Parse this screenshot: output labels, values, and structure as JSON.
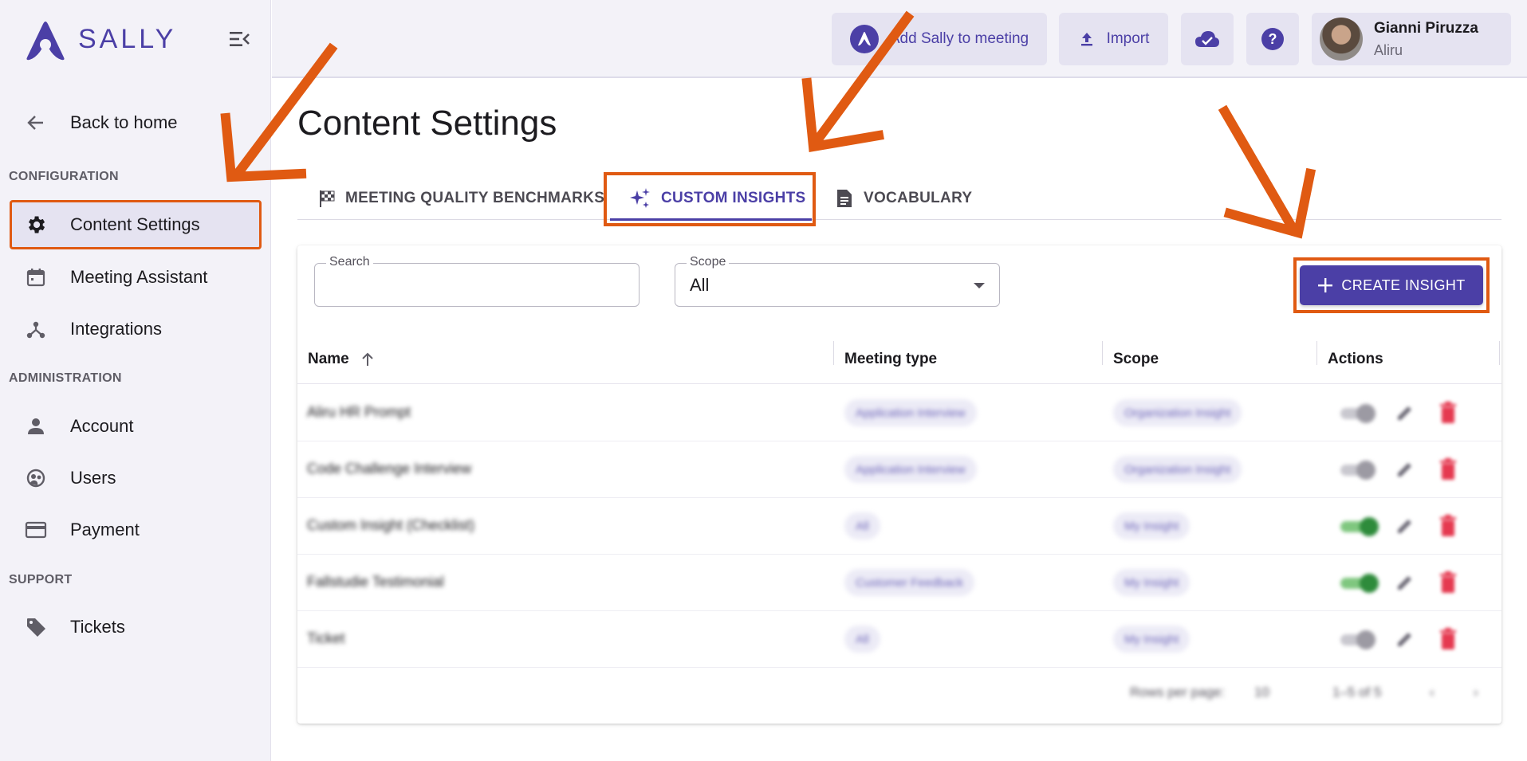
{
  "app": {
    "logo_text": "SALLY"
  },
  "topbar": {
    "add_sally_label": "Add Sally to meeting",
    "import_label": "Import",
    "user_name": "Gianni Piruzza",
    "user_org": "Aliru"
  },
  "sidebar": {
    "back_label": "Back to home",
    "sections": {
      "configuration": "CONFIGURATION",
      "administration": "ADMINISTRATION",
      "support": "SUPPORT"
    },
    "items": {
      "content_settings": "Content Settings",
      "meeting_assistant": "Meeting Assistant",
      "integrations": "Integrations",
      "account": "Account",
      "users": "Users",
      "payment": "Payment",
      "tickets": "Tickets"
    }
  },
  "page": {
    "title": "Content Settings"
  },
  "tabs": {
    "benchmarks": "MEETING QUALITY BENCHMARKS",
    "insights": "CUSTOM INSIGHTS",
    "vocabulary": "VOCABULARY"
  },
  "filters": {
    "search_label": "Search",
    "search_value": "",
    "scope_label": "Scope",
    "scope_value": "All"
  },
  "create_button": "CREATE INSIGHT",
  "table": {
    "columns": [
      "Name",
      "Meeting type",
      "Scope",
      "Actions"
    ],
    "rows": [
      {
        "name": "Aliru HR Prompt",
        "meeting_type": "Application Interview",
        "scope": "Organization Insight",
        "enabled": false
      },
      {
        "name": "Code Challenge Interview",
        "meeting_type": "Application Interview",
        "scope": "Organization Insight",
        "enabled": false
      },
      {
        "name": "Custom Insight (Checklist)",
        "meeting_type": "All",
        "scope": "My Insight",
        "enabled": true
      },
      {
        "name": "Fallstudie Testimonial",
        "meeting_type": "Customer Feedback",
        "scope": "My Insight",
        "enabled": true
      },
      {
        "name": "Ticket",
        "meeting_type": "All",
        "scope": "My Insight",
        "enabled": false
      }
    ]
  },
  "pagination": {
    "rows_per_page_label": "Rows per page:",
    "rows_per_page_value": "10",
    "range": "1–5 of 5"
  },
  "colors": {
    "brand": "#4b3fa6",
    "annotation": "#e05a12",
    "sidebar_bg": "#f3f2f8",
    "toggle_on": "#2e8b3b",
    "delete": "#e53950"
  }
}
